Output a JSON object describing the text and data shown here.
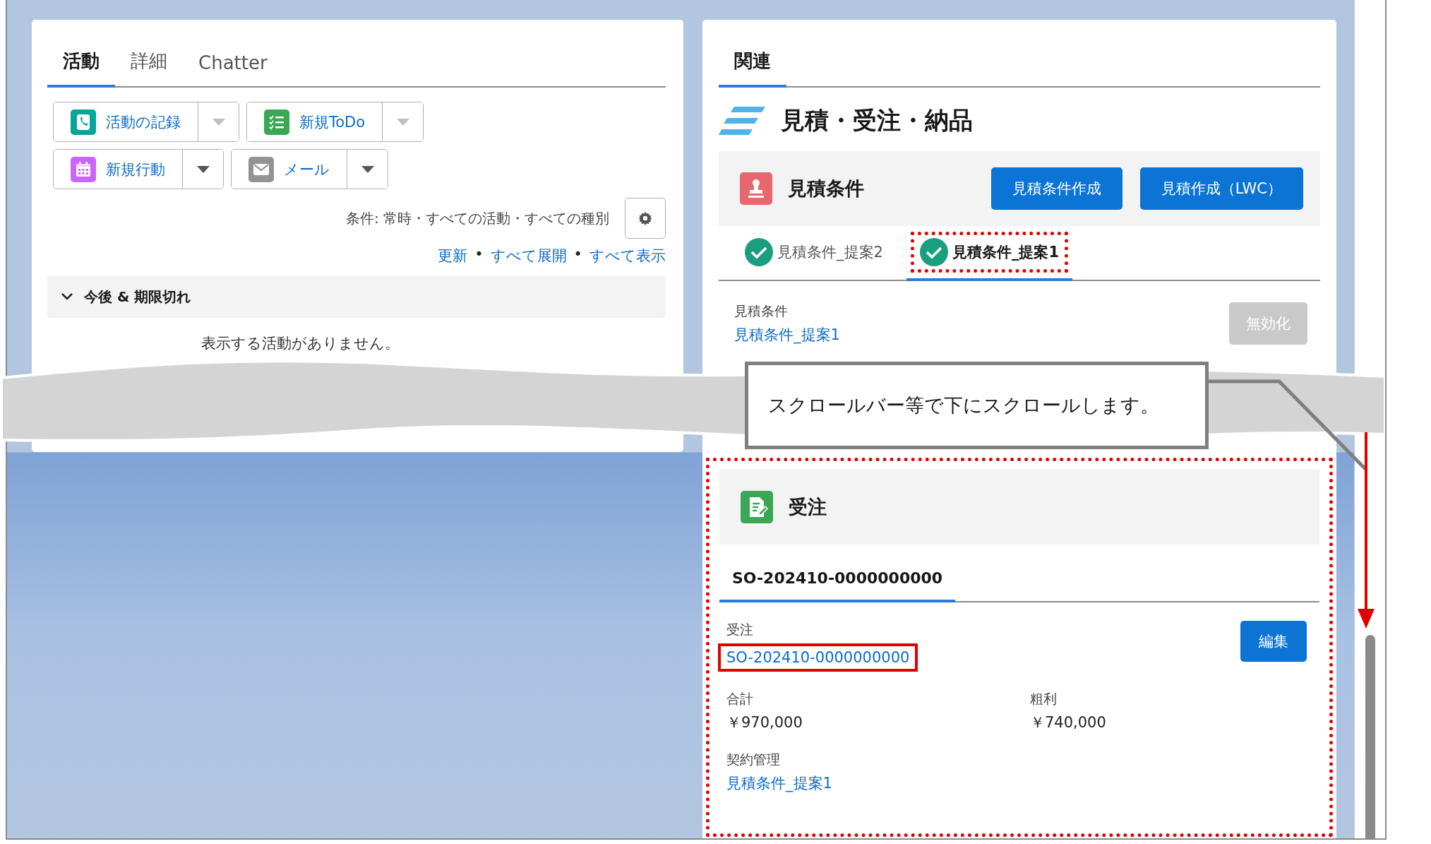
{
  "activity_panel": {
    "tabs": [
      {
        "label": "活動",
        "selected": true
      },
      {
        "label": "詳細",
        "selected": false
      },
      {
        "label": "Chatter",
        "selected": false
      }
    ],
    "action_rows": [
      {
        "buttons": [
          {
            "label": "活動の記録",
            "dropdown_disabled": true
          },
          {
            "label": "新規ToDo",
            "dropdown_disabled": true
          }
        ]
      },
      {
        "buttons": [
          {
            "label": "新規行動",
            "dropdown_disabled": false
          },
          {
            "label": "メール",
            "dropdown_disabled": false
          }
        ]
      }
    ],
    "filter_text": "条件: 常時・すべての活動・すべての種別",
    "links": [
      "更新",
      "すべて展開",
      "すべて表示"
    ],
    "link_separator": "•",
    "section": {
      "title": "今後 & 期限切れ",
      "expanded": true
    },
    "empty_message": "表示する活動がありません。"
  },
  "related_panel": {
    "tabs": [
      {
        "label": "関連",
        "selected": true
      }
    ],
    "title": "見積・受注・納品",
    "quote_conditions": {
      "title": "見積条件",
      "buttons": [
        "見積条件作成",
        "見積作成（LWC）"
      ],
      "tabs": [
        {
          "label": "見積条件_提案2",
          "selected": false,
          "highlighted": false
        },
        {
          "label": "見積条件_提案1",
          "selected": true,
          "highlighted": true
        }
      ],
      "field": {
        "label": "見積条件",
        "value": "見積条件_提案1"
      },
      "deactivate_button": {
        "label": "無効化",
        "disabled": true
      }
    },
    "orders": {
      "title": "受注",
      "highlighted": true,
      "tabs": [
        {
          "label": "SO-202410-0000000000",
          "selected": true
        }
      ],
      "edit_button": "編集",
      "fields": [
        {
          "label": "受注",
          "value": "SO-202410-0000000000",
          "kind": "link",
          "highlighted": true
        },
        {
          "label": "合計",
          "value": "￥970,000",
          "kind": "text",
          "highlighted": false
        },
        {
          "label": "粗利",
          "value": "￥740,000",
          "kind": "text",
          "highlighted": false
        },
        {
          "label": "契約管理",
          "value": "見積条件_提案1",
          "kind": "link",
          "highlighted": false
        }
      ]
    }
  },
  "annotation": {
    "callout": "スクロールバー等で下にスクロールします。"
  }
}
